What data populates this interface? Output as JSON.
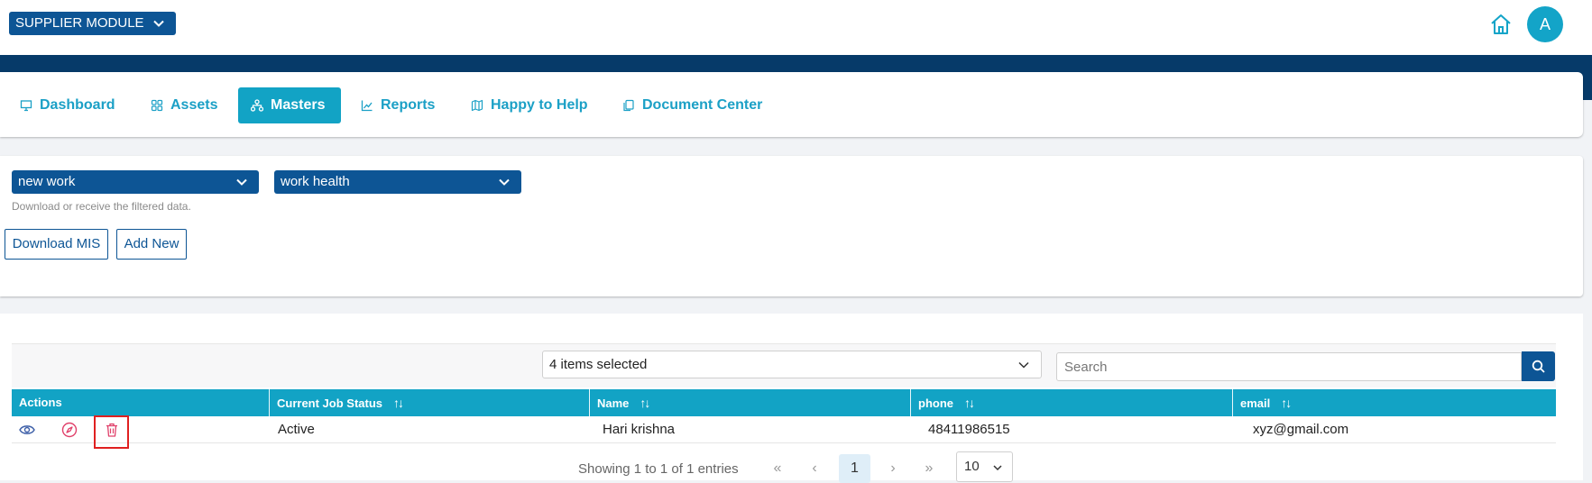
{
  "header": {
    "module_label": "SUPPLIER MODULE",
    "avatar_initial": "A"
  },
  "nav": {
    "items": [
      {
        "label": "Dashboard",
        "icon": "monitor-icon"
      },
      {
        "label": "Assets",
        "icon": "grid-icon"
      },
      {
        "label": "Masters",
        "icon": "sitemap-icon",
        "active": true
      },
      {
        "label": "Reports",
        "icon": "chart-line-icon"
      },
      {
        "label": "Happy to Help",
        "icon": "map-icon"
      },
      {
        "label": "Document Center",
        "icon": "documents-icon"
      }
    ]
  },
  "filters": {
    "first_select": "new work",
    "second_select": "work health",
    "hint": "Download or receive the filtered data.",
    "download_label": "Download MIS",
    "add_label": "Add New"
  },
  "table": {
    "columns_select": "4 items selected",
    "search_placeholder": "Search",
    "headers": [
      "Actions",
      "Current Job Status",
      "Name",
      "phone",
      "email"
    ],
    "rows": [
      {
        "status": "Active",
        "name": "Hari krishna",
        "phone": "48411986515",
        "email": "xyz@gmail.com"
      }
    ],
    "pagination": {
      "info": "Showing 1 to 1 of 1 entries",
      "first": "«",
      "prev": "‹",
      "current": "1",
      "next": "›",
      "last": "»",
      "page_size": "10"
    }
  },
  "colors": {
    "brand_dark": "#0d5595",
    "band": "#063a69",
    "accent": "#12a3c5",
    "danger": "#e02020"
  }
}
